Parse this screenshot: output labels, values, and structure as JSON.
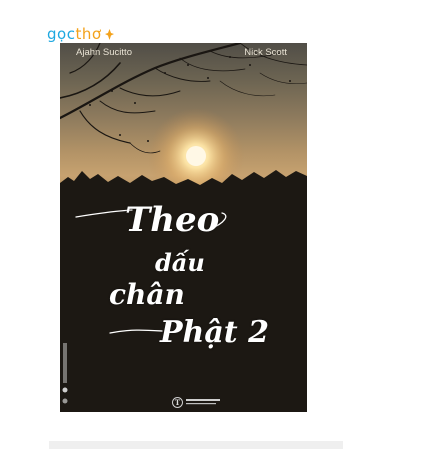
{
  "brand": {
    "part1": "gọc",
    "part2": "thơ"
  },
  "book": {
    "author_left": "Ajahn Sucitto",
    "author_right": "Nick Scott",
    "title_lines": [
      "Theo",
      "dấu",
      "chân",
      "Phật 2"
    ],
    "publisher_mark": "T"
  },
  "colors": {
    "brand_blue": "#1fa8e0",
    "brand_orange": "#f3a21b",
    "title_text": "#ffffff"
  }
}
